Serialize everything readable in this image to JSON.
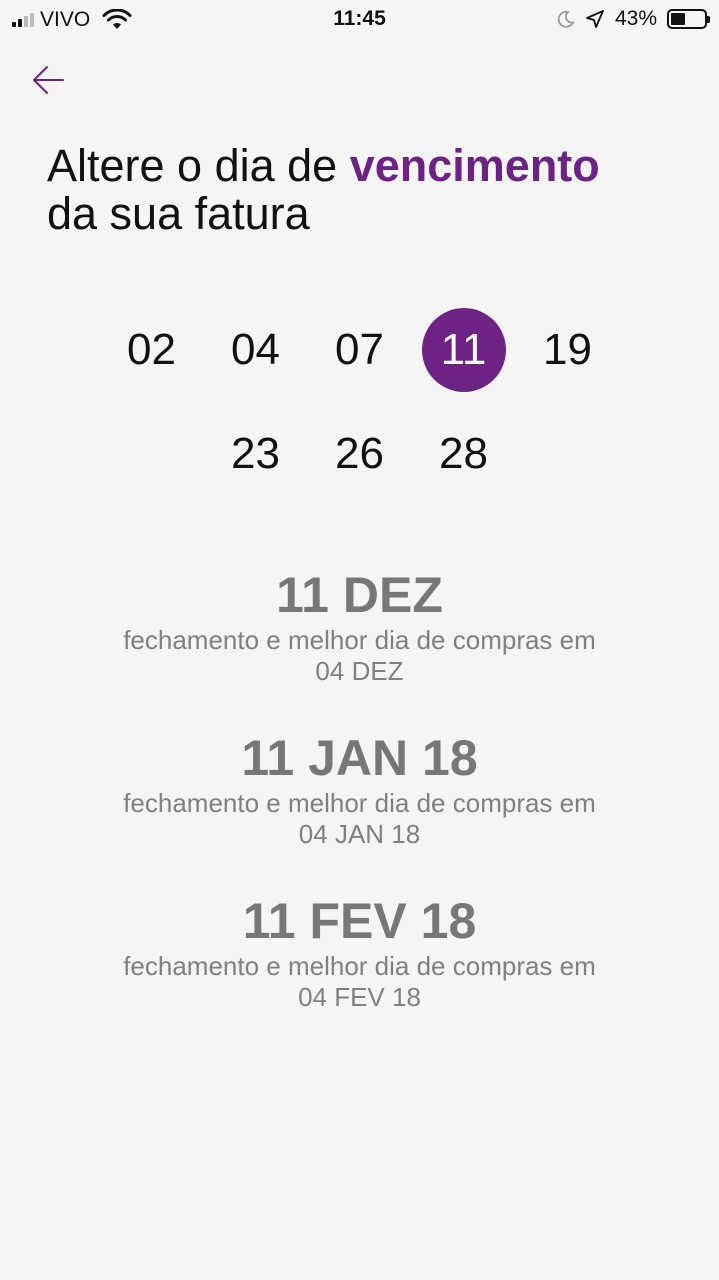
{
  "status_bar": {
    "carrier": "VIVO",
    "time": "11:45",
    "battery_percent": "43%",
    "battery_level": 0.43,
    "icons": [
      "signal-icon",
      "wifi-icon",
      "moon-icon",
      "location-arrow-icon",
      "battery-icon"
    ]
  },
  "header": {
    "back_icon": "arrow-left-icon"
  },
  "title": {
    "prefix": "Altere o dia de ",
    "highlight": "vencimento",
    "suffix": "da sua fatura"
  },
  "colors": {
    "accent": "#6c2384",
    "text_dark": "#111111",
    "text_muted": "#777777",
    "background": "#f5f5f5"
  },
  "day_picker": {
    "row1": [
      "02",
      "04",
      "07",
      "11",
      "19"
    ],
    "row2": [
      "23",
      "26",
      "28"
    ],
    "selected": "11"
  },
  "dates": [
    {
      "due": "11 DEZ",
      "closing_label": "fechamento e melhor dia de compras em",
      "closing": "04 DEZ"
    },
    {
      "due": "11 JAN 18",
      "closing_label": "fechamento e melhor dia de compras em",
      "closing": "04 JAN 18"
    },
    {
      "due": "11 FEV 18",
      "closing_label": "fechamento e melhor dia de compras em",
      "closing": "04 FEV 18"
    }
  ]
}
